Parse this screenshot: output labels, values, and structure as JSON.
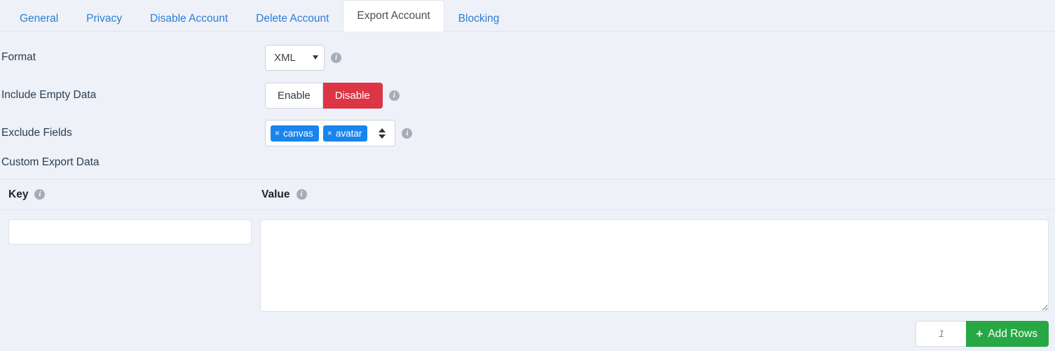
{
  "tabs": [
    {
      "label": "General",
      "active": false
    },
    {
      "label": "Privacy",
      "active": false
    },
    {
      "label": "Disable Account",
      "active": false
    },
    {
      "label": "Delete Account",
      "active": false
    },
    {
      "label": "Export Account",
      "active": true
    },
    {
      "label": "Blocking",
      "active": false
    }
  ],
  "form": {
    "format": {
      "label": "Format",
      "value": "XML",
      "info": "i"
    },
    "include_empty_data": {
      "label": "Include Empty Data",
      "enable_label": "Enable",
      "disable_label": "Disable",
      "active": "Disable",
      "info": "i"
    },
    "exclude_fields": {
      "label": "Exclude Fields",
      "tags": [
        "canvas",
        "avatar"
      ],
      "remove_glyph": "×",
      "info": "i"
    }
  },
  "custom_export": {
    "title": "Custom Export Data",
    "key_header": "Key",
    "value_header": "Value",
    "key_info": "i",
    "value_info": "i",
    "key_value": "",
    "value_value": ""
  },
  "add_rows": {
    "count_placeholder": "1",
    "count_value": "",
    "plus_glyph": "+",
    "label": "Add Rows"
  },
  "colors": {
    "page_bg": "#eef1f8",
    "tab_link": "#2a7fd4",
    "danger": "#dc3545",
    "success": "#28a745",
    "tag_blue": "#1a84ee"
  }
}
